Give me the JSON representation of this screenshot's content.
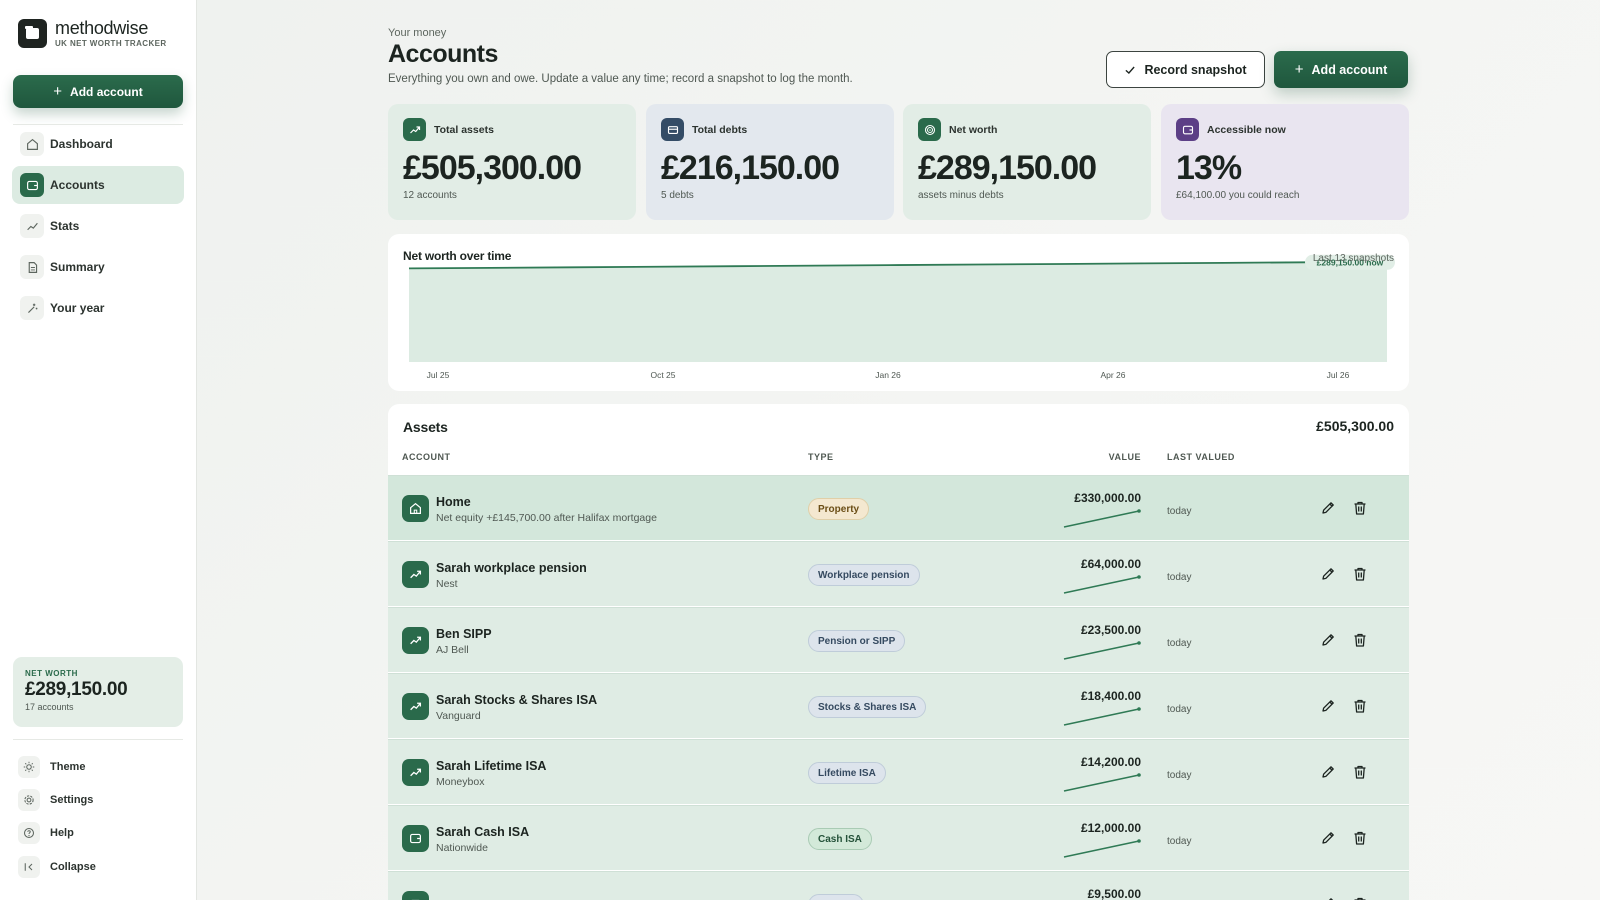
{
  "sidebar": {
    "brand_name": "methodwise",
    "brand_tagline": "UK NET WORTH TRACKER",
    "add_account_label": "Add account",
    "nav": [
      {
        "label": "Dashboard",
        "icon": "home-icon"
      },
      {
        "label": "Accounts",
        "icon": "wallet-icon"
      },
      {
        "label": "Stats",
        "icon": "trend-icon"
      },
      {
        "label": "Summary",
        "icon": "document-icon"
      },
      {
        "label": "Your year",
        "icon": "sparkle-icon"
      }
    ],
    "networth": {
      "label": "NET WORTH",
      "value": "£289,150.00",
      "sub": "17 accounts"
    },
    "footer": [
      {
        "label": "Theme",
        "icon": "sun-icon"
      },
      {
        "label": "Settings",
        "icon": "gear-icon"
      },
      {
        "label": "Help",
        "icon": "help-icon"
      },
      {
        "label": "Collapse",
        "icon": "collapse-icon"
      }
    ]
  },
  "header": {
    "eyebrow": "Your money",
    "title": "Accounts",
    "subtitle": "Everything you own and owe. Update a value any time; record a snapshot to log the month.",
    "record_label": "Record snapshot",
    "add_label": "Add account"
  },
  "stats": [
    {
      "label": "Total assets",
      "value": "£505,300.00",
      "sub": "12 accounts",
      "bg": "#e2ede6",
      "icon_bg": "#2a6a4b"
    },
    {
      "label": "Total debts",
      "value": "£216,150.00",
      "sub": "5 debts",
      "bg": "#e3e8ee",
      "icon_bg": "#344c66"
    },
    {
      "label": "Net worth",
      "value": "£289,150.00",
      "sub": "assets minus debts",
      "bg": "#e2ede6",
      "icon_bg": "#2a6a4b"
    },
    {
      "label": "Accessible now",
      "value": "13%",
      "sub": "£64,100.00 you could reach",
      "bg": "#e9e5f0",
      "icon_bg": "#5c3f86"
    }
  ],
  "chart": {
    "title": "Net worth over time",
    "range": "Last 13 snapshots",
    "now_label": "£289,150.00 now"
  },
  "chart_data": {
    "type": "area",
    "x_ticks": [
      "Jul 25",
      "Oct 25",
      "Jan 26",
      "Apr 26",
      "Jul 26"
    ],
    "x": [
      "Jul 25",
      "Aug 25",
      "Sep 25",
      "Oct 25",
      "Nov 25",
      "Dec 25",
      "Jan 26",
      "Feb 26",
      "Mar 26",
      "Apr 26",
      "May 26",
      "Jun 26",
      "Jul 26"
    ],
    "values": [
      270000,
      271600,
      273200,
      274800,
      276400,
      278000,
      279600,
      281200,
      282800,
      284400,
      286000,
      287600,
      289150
    ],
    "ylim": [
      0,
      300000
    ],
    "grid": false
  },
  "assets": {
    "title": "Assets",
    "total": "£505,300.00",
    "columns": {
      "account": "ACCOUNT",
      "type": "TYPE",
      "value": "VALUE",
      "last": "LAST VALUED"
    },
    "rows": [
      {
        "name": "Home",
        "sub": "Net equity +£145,700.00 after Halifax mortgage",
        "type": "Property",
        "pill": "property",
        "value": "£330,000.00",
        "date": "today",
        "icon": "home-icon"
      },
      {
        "name": "Sarah workplace pension",
        "sub": "Nest",
        "type": "Workplace pension",
        "pill": "blue",
        "value": "£64,000.00",
        "date": "today",
        "icon": "trend-icon"
      },
      {
        "name": "Ben SIPP",
        "sub": "AJ Bell",
        "type": "Pension or SIPP",
        "pill": "blue",
        "value": "£23,500.00",
        "date": "today",
        "icon": "trend-icon"
      },
      {
        "name": "Sarah Stocks & Shares ISA",
        "sub": "Vanguard",
        "type": "Stocks & Shares ISA",
        "pill": "blue",
        "value": "£18,400.00",
        "date": "today",
        "icon": "trend-icon"
      },
      {
        "name": "Sarah Lifetime ISA",
        "sub": "Moneybox",
        "type": "Lifetime ISA",
        "pill": "blue",
        "value": "£14,200.00",
        "date": "today",
        "icon": "trend-icon"
      },
      {
        "name": "Sarah Cash ISA",
        "sub": "Nationwide",
        "type": "Cash ISA",
        "pill": "green",
        "value": "£12,000.00",
        "date": "today",
        "icon": "wallet-icon"
      },
      {
        "name": "",
        "sub": "",
        "type": "",
        "pill": "blue",
        "value": "£9,500.00",
        "date": "",
        "icon": "wallet-icon"
      }
    ]
  }
}
